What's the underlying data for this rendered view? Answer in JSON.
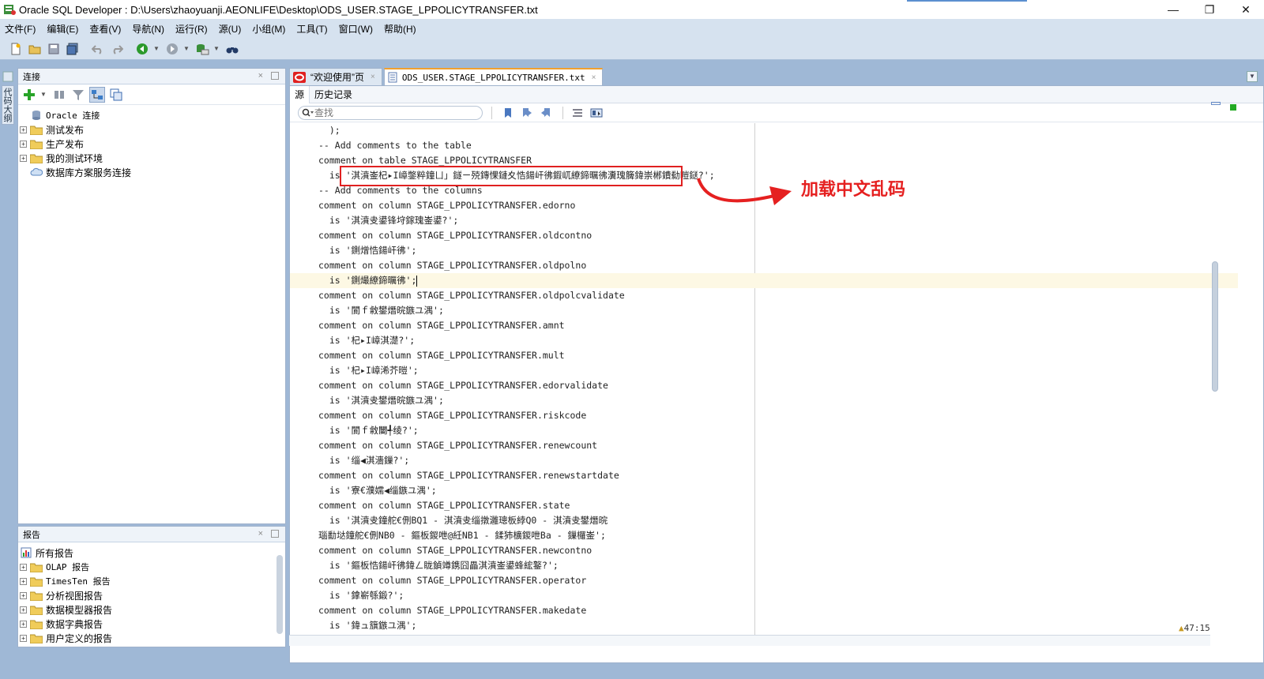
{
  "window": {
    "title": "Oracle SQL Developer : D:\\Users\\zhaoyuanji.AEONLIFE\\Desktop\\ODS_USER.STAGE_LPPOLICYTRANSFER.txt"
  },
  "menubar": {
    "items": [
      "文件(F)",
      "编辑(E)",
      "查看(V)",
      "导航(N)",
      "运行(R)",
      "源(U)",
      "小组(M)",
      "工具(T)",
      "窗口(W)",
      "帮助(H)"
    ]
  },
  "connections_panel": {
    "title": "连接",
    "tree": [
      {
        "label": "Oracle 连接",
        "mono": true
      },
      {
        "label": "测试发布"
      },
      {
        "label": "生产发布"
      },
      {
        "label": "我的测试环境"
      },
      {
        "label": "数据库方案服务连接"
      }
    ]
  },
  "side_tab": {
    "label": "代码大纲"
  },
  "reports_panel": {
    "title": "报告",
    "tree": [
      {
        "label": "所有报告"
      },
      {
        "label": "OLAP 报告"
      },
      {
        "label": "TimesTen 报告"
      },
      {
        "label": "分析视图报告"
      },
      {
        "label": "数据模型器报告"
      },
      {
        "label": "数据字典报告"
      },
      {
        "label": "用户定义的报告"
      }
    ]
  },
  "editor": {
    "tabs": [
      {
        "label": "“欢迎使用”页"
      },
      {
        "label": "ODS_USER.STAGE_LPPOLICYTRANSFER.txt",
        "active": true
      }
    ],
    "subtabs": [
      "源",
      "历史记录"
    ],
    "find_placeholder": "查找",
    "cursor_position": "47:15",
    "annotation": "加载中文乱码",
    "lines": [
      "  );",
      "-- Add comments to the table",
      "comment on table STAGE_LPPOLICYTRANSFER",
      "  is '淇濆崟杞▸I嶂鐅粹鐘ㄩ」鐩ㄧ殑鏄惈鏈夊悎鍚屽彿鍜屼繚鍗曞彿瀵瑰簲鍏崇郴鐨勬暟鎹?';",
      "-- Add comments to the columns",
      "comment on column STAGE_LPPOLICYTRANSFER.edorno",
      "  is '淇濆叏鍙锋垨鎵瑰崟鍙?';",
      "comment on column STAGE_LPPOLICYTRANSFER.oldcontno",
      "  is '鍘熷悎鍚屽彿';",
      "comment on column STAGE_LPPOLICYTRANSFER.oldpolno",
      "  is '鍘熶繚鍗曞彿';",
      "comment on column STAGE_LPPOLICYTRANSFER.oldpolcvalidate",
      "  is '閬ｆ敹鐢熸晥鏃ユ湡';",
      "comment on column STAGE_LPPOLICYTRANSFER.amnt",
      "  is '杞▸I嶂淇濋?';",
      "comment on column STAGE_LPPOLICYTRANSFER.mult",
      "  is '杞▸I嶂浠芥暟';",
      "comment on column STAGE_LPPOLICYTRANSFER.edorvalidate",
      "  is '淇濆叏鐢熸晥鏃ユ湡';",
      "comment on column STAGE_LPPOLICYTRANSFER.riskcode",
      "  is '閬ｆ敹闄╃绫?';",
      "comment on column STAGE_LPPOLICYTRANSFER.renewcount",
      "  is '缁◀淇濇鏁?';",
      "comment on column STAGE_LPPOLICYTRANSFER.renewstartdate",
      "  is '寮€濮嬬◀缁鏃ユ湡';",
      "comment on column STAGE_LPPOLICYTRANSFER.state",
      "  is '淇濆叏鐘舵€侀BQ1 - 淇濆叏缁撴灉璁板綍Q0 - 淇濆叏鐢熸晥",
      "瑙勫垯鐘舵€侀NB0 - 鏂板鍐呭@紝NB1 - 鍒犻櫎鍐呭Ba - 鏁欏崟';",
      "comment on column STAGE_LPPOLICYTRANSFER.newcontno",
      "  is '鏂板悎鍚屽彿鍏ㄥ眬鍞竴鎸囧畾淇濆崟鍙蜂綋鐜?';",
      "comment on column STAGE_LPPOLICYTRANSFER.operator",
      "  is '鎿嶄綔鍛?';",
      "comment on column STAGE_LPPOLICYTRANSFER.makedate",
      "  is '鍏ュ簱鏃ユ湡';"
    ]
  }
}
